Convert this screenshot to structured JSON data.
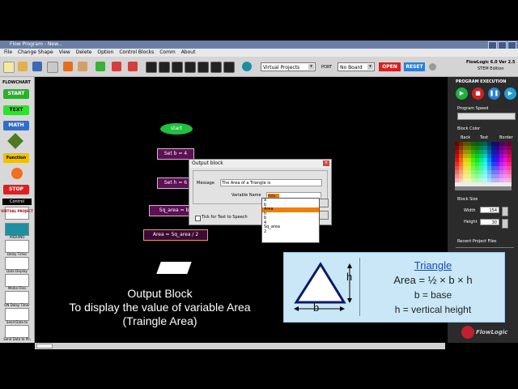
{
  "window": {
    "title": "Flow Program - New..."
  },
  "menu": [
    "File",
    "Change Shape",
    "View",
    "Delete",
    "Option",
    "Control Blocks",
    "Comm",
    "About"
  ],
  "toolbar": {
    "project_select": "Virtual Projects",
    "port_label": "PORT",
    "port_select": "No Board",
    "open_label": "OPEN",
    "reset_label": "RESET",
    "version": "FlowLogic 6.0 Ver 2.5",
    "edition": "STEM Edition"
  },
  "palette": {
    "header": "FLOWCHART",
    "start": "START",
    "text": "TEXT",
    "math": "MATH",
    "function": "Function",
    "stop": "STOP",
    "control_header": "Control",
    "items": [
      "VIRTUAL PROJECT",
      "ARDUINO",
      "Delay Timer",
      "Data Display",
      "Media Files",
      "ON Delay Timer",
      "Send Data to Arduino",
      "Send Data to Pin"
    ]
  },
  "canvas": {
    "start_block": "start",
    "block1": "Set b = 4",
    "block2": "Set h = 6",
    "block3": "Sq_area = b",
    "block4": "Area = Sq_area / 2"
  },
  "dialog": {
    "title": "Output block",
    "message_label": "Message",
    "message_value": "The Area of a Triangle is",
    "variable_label": "Variable Name",
    "variable_value": "Area",
    "checkbox_label": "Tick for Text to Speech",
    "dropdown_options": [
      "a",
      "b",
      "Area",
      "h",
      "b",
      "4",
      "Sq_area",
      "2"
    ],
    "dropdown_selected": "Area"
  },
  "right_panel": {
    "program_execution": "PROGRAM EXECUTION",
    "program_speed": "Program Speed",
    "block_color": "Block Color",
    "radio_back": "Back",
    "radio_text": "Text",
    "radio_border": "Border",
    "block_size": "Block Size",
    "width_label": "Width",
    "width_value": "154",
    "height_label": "Height",
    "height_value": "30",
    "recent_files": "Recent Project Files"
  },
  "caption": {
    "line1": "Output Block",
    "line2": "To display the value of variable Area",
    "line3": "(Traingle Area)"
  },
  "triangle_card": {
    "title": "Triangle",
    "formula": "Area = ½ × b × h",
    "b_def": "b = base",
    "h_def": "h = vertical height",
    "h_label": "h",
    "b_label": "b"
  },
  "logo": {
    "text": "FlowLogic"
  },
  "colors": {
    "green": "#1f9e3a",
    "red": "#d42020",
    "blue": "#2060c8",
    "purple_block": "#5c1055",
    "orange": "#f08000"
  }
}
